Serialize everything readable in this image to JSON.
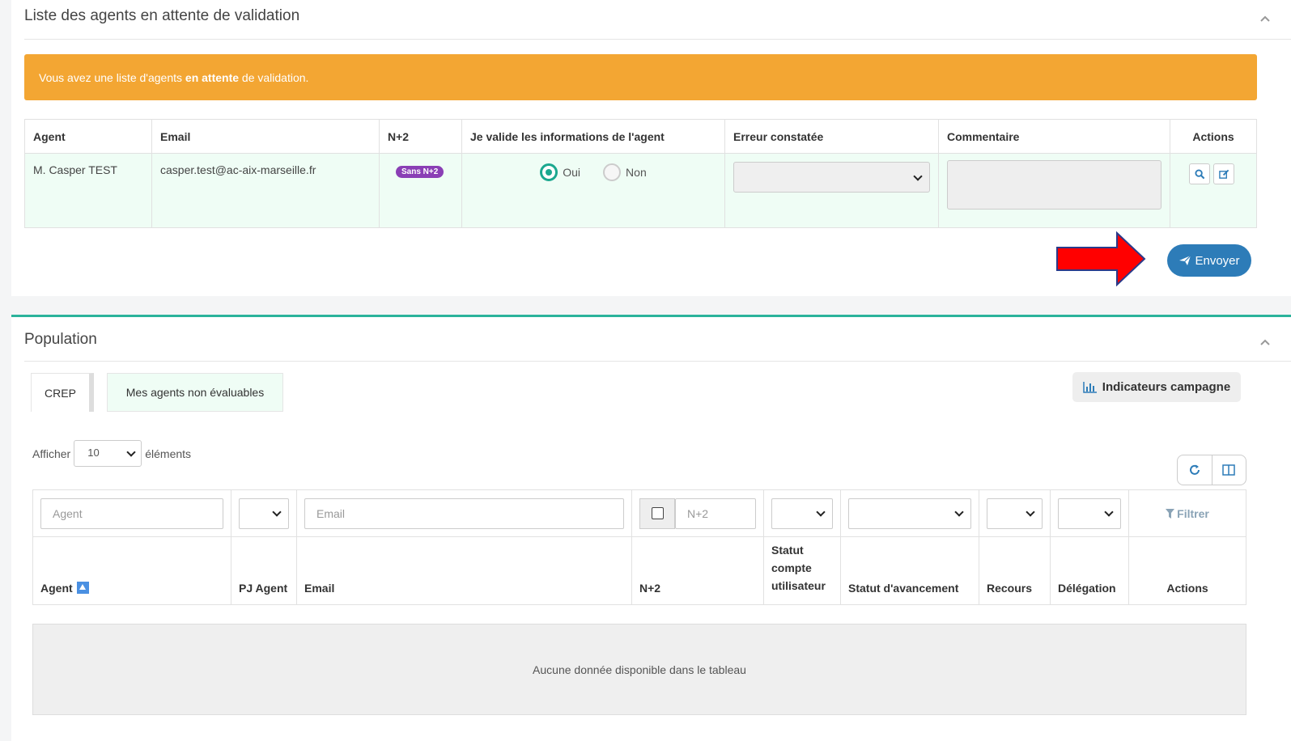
{
  "validation_panel": {
    "title": "Liste des agents en attente de validation",
    "alert": {
      "prefix": "Vous avez une liste d'agents ",
      "bold": "en attente",
      "suffix": " de validation."
    },
    "columns": [
      "Agent",
      "Email",
      "N+2",
      "Je valide les informations de l'agent",
      "Erreur constatée",
      "Commentaire",
      "Actions"
    ],
    "row": {
      "agent": "M. Casper TEST",
      "email": "casper.test@ac-aix-marseille.fr",
      "n2_badge": "Sans N+2",
      "radio_yes": "Oui",
      "radio_no": "Non",
      "selected": "Oui"
    },
    "send_label": "Envoyer"
  },
  "population_panel": {
    "title": "Population",
    "tabs": [
      "CREP",
      "Mes agents non évaluables"
    ],
    "indicators_label": "Indicateurs campagne",
    "length": {
      "before": "Afficher",
      "value": "10",
      "after": "éléments"
    },
    "filters": {
      "agent_placeholder": "Agent",
      "email_placeholder": "Email",
      "n2_placeholder": "N+2",
      "filter_label": "Filtrer"
    },
    "columns": [
      "Agent",
      "PJ Agent",
      "Email",
      "N+2",
      "Statut compte utilisateur",
      "Statut d'avancement",
      "Recours",
      "Délégation",
      "Actions"
    ],
    "empty_message": "Aucune donnée disponible dans le tableau"
  },
  "colors": {
    "alert": "#f3a633",
    "primary": "#2d7cb8",
    "teal": "#1ba88f",
    "badge": "#8a3fb5",
    "arrow": "#ff0000"
  }
}
